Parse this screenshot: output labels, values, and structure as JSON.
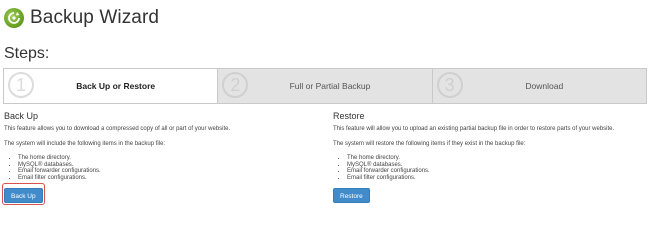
{
  "header": {
    "title": "Backup Wizard",
    "icon": "backup-wizard-icon"
  },
  "steps": {
    "label": "Steps:",
    "items": [
      {
        "num": "1",
        "label": "Back Up or Restore",
        "active": true
      },
      {
        "num": "2",
        "label": "Full or Partial Backup",
        "active": false
      },
      {
        "num": "3",
        "label": "Download",
        "active": false
      }
    ]
  },
  "backup": {
    "heading": "Back Up",
    "description": "This feature allows you to download a compressed copy of all or part of your website.",
    "includes_intro": "The system will include the following items in the backup file:",
    "items": [
      "The home directory.",
      "MySQL® databases.",
      "Email forwarder configurations.",
      "Email filter configurations."
    ],
    "button": "Back Up"
  },
  "restore": {
    "heading": "Restore",
    "description": "This feature will allow you to upload an existing partial backup file in order to restore parts of your website.",
    "includes_intro": "The system will restore the following items if they exist in the backup file:",
    "items": [
      "The home directory.",
      "MySQL® databases.",
      "Email forwarder configurations.",
      "Email filter configurations."
    ],
    "button": "Restore"
  },
  "colors": {
    "primary_button": "#428bca",
    "highlight": "#d9534f",
    "logo": "#6aa324"
  }
}
